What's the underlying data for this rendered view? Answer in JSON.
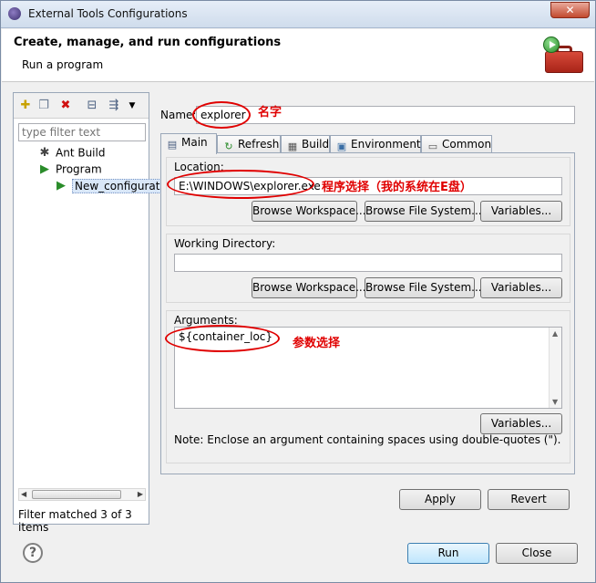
{
  "window": {
    "title": "External Tools Configurations",
    "close_glyph": "✕"
  },
  "header": {
    "title": "Create, manage, and run configurations",
    "subtitle": "Run a program"
  },
  "left": {
    "filter_placeholder": "type filter text",
    "tree": [
      {
        "label": "Ant Build",
        "icon": "ant-icon"
      },
      {
        "label": "Program",
        "icon": "program-icon"
      },
      {
        "label": "New_configuration",
        "icon": "launch-config-icon"
      }
    ],
    "status": "Filter matched 3 of 3 items"
  },
  "right": {
    "name_label": "Name:",
    "name_value": "explorer",
    "tabs": [
      "Main",
      "Refresh",
      "Build",
      "Environment",
      "Common"
    ],
    "location": {
      "label": "Location:",
      "value": "E:\\WINDOWS\\explorer.exe",
      "buttons": [
        "Browse Workspace...",
        "Browse File System...",
        "Variables..."
      ]
    },
    "working_dir": {
      "label": "Working Directory:",
      "value": "",
      "buttons": [
        "Browse Workspace...",
        "Browse File System...",
        "Variables..."
      ]
    },
    "arguments": {
      "label": "Arguments:",
      "value": "${container_loc}",
      "variables_button": "Variables...",
      "note": "Note: Enclose an argument containing spaces using double-quotes (\")."
    },
    "apply_button": "Apply",
    "revert_button": "Revert"
  },
  "footer": {
    "help": "?",
    "run_button": "Run",
    "close_button": "Close"
  },
  "annotations": {
    "name": "名字",
    "location": "程序选择（我的系统在E盘）",
    "arguments": "参数选择",
    "color": "#e00000"
  }
}
